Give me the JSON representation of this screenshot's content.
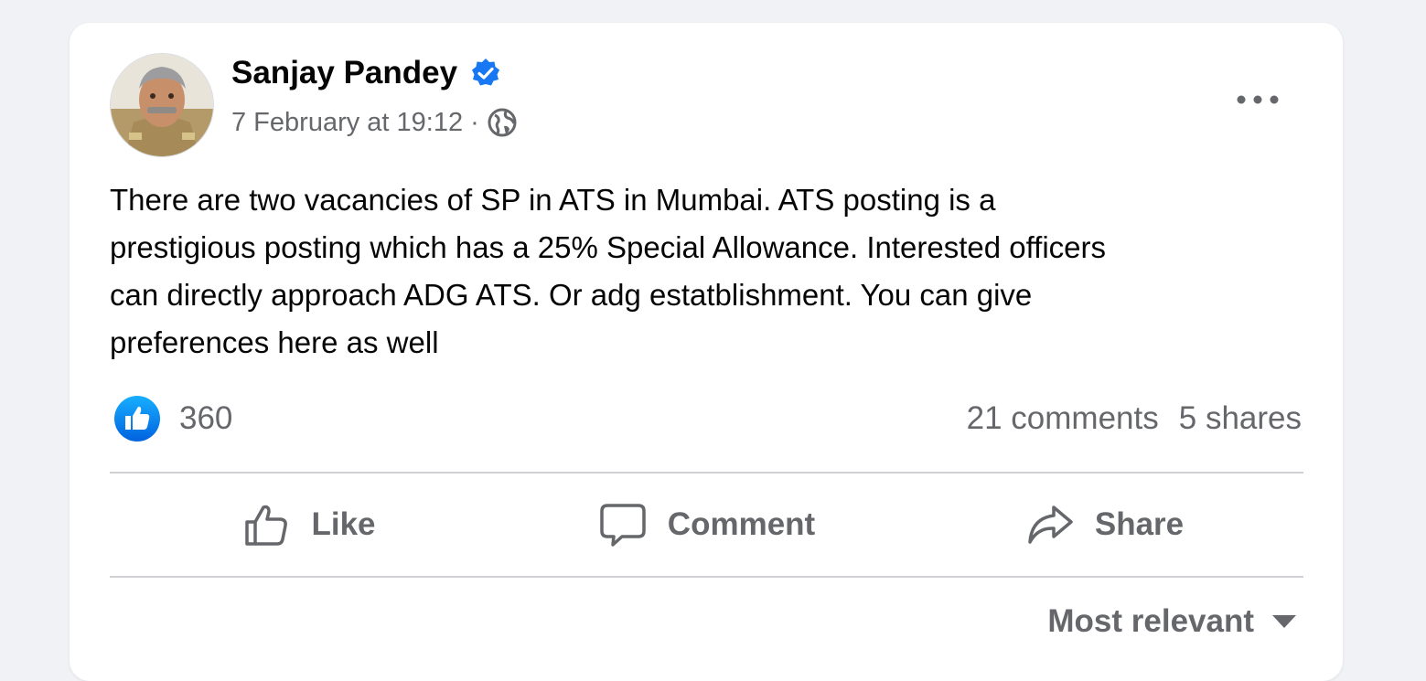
{
  "post": {
    "author": "Sanjay Pandey",
    "date": "7 February at 19:12",
    "separator": "·",
    "privacy_icon": "globe-icon",
    "text": "There are two vacancies of SP in ATS in Mumbai. ATS posting is a\nprestigious posting which has a 25% Special Allowance. Interested officers\ncan directly approach ADG ATS. Or adg estatblishment.  You can give\npreferences here as well"
  },
  "stats": {
    "reaction_count": "360",
    "comments": "21 comments",
    "shares": "5 shares"
  },
  "actions": {
    "like": "Like",
    "comment": "Comment",
    "share": "Share"
  },
  "comments_sort": {
    "label": "Most relevant"
  },
  "colors": {
    "background": "#f0f2f5",
    "card": "#ffffff",
    "brand_blue": "#1877f2",
    "secondary_text": "#65676b",
    "primary_text": "#050505"
  }
}
